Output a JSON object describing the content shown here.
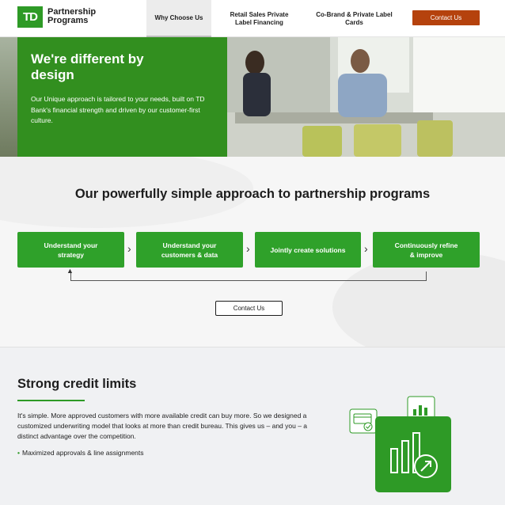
{
  "header": {
    "logo_text": "TD",
    "brand_line1": "Partnership",
    "brand_line2": "Programs",
    "nav": [
      {
        "label": "Why Choose Us"
      },
      {
        "label_line1": "Retail Sales Private",
        "label_line2": "Label Financing"
      },
      {
        "label_line1": "Co-Brand & Private Label",
        "label_line2": "Cards"
      }
    ],
    "contact_label": "Contact Us",
    "accent_color": "#b5420d"
  },
  "hero": {
    "title_line1": "We're different by",
    "title_line2": "design",
    "text": "Our Unique approach is tailored to your needs, built on TD Bank's financial strength and driven by our customer-first culture.",
    "card_color": "#328f1f"
  },
  "approach": {
    "title": "Our powerfully simple approach to partnership programs",
    "steps": [
      {
        "line1": "Understand your",
        "line2": "strategy"
      },
      {
        "line1": "Understand your",
        "line2": "customers & data"
      },
      {
        "line1": "Jointly create solutions",
        "line2": ""
      },
      {
        "line1": "Continuously refine",
        "line2": "& improve"
      }
    ],
    "contact_label": "Contact Us",
    "step_color": "#2fa12a"
  },
  "credit": {
    "title": "Strong credit limits",
    "text": "It's simple. More approved customers with more available credit can buy more. So we designed a customized underwriting model that looks at more than credit bureau. This gives us – and you – a distinct advantage over the competition.",
    "bullet": "Maximized approvals & line assignments"
  }
}
